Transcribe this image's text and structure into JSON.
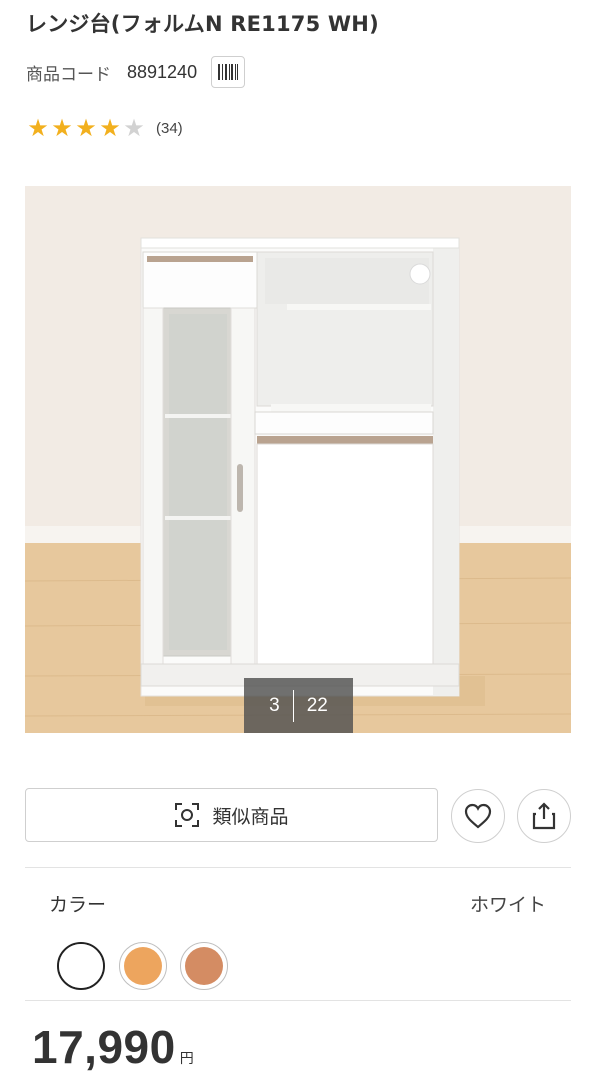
{
  "product": {
    "title": "レンジ台(フォルムN RE1175 WH)",
    "code_label": "商品コード",
    "code_value": "8891240",
    "rating": 4,
    "rating_max": 5,
    "review_count": "(34)"
  },
  "gallery": {
    "current": "3",
    "total": "22"
  },
  "actions": {
    "similar_label": "類似商品",
    "similar_icon": "image-search-icon",
    "favorite_icon": "heart-icon",
    "share_icon": "share-icon"
  },
  "color_section": {
    "label": "カラー",
    "selected_name": "ホワイト",
    "swatches": [
      {
        "name": "white",
        "hex": "#ffffff"
      },
      {
        "name": "orange",
        "hex": "#eda55e"
      },
      {
        "name": "brown",
        "hex": "#d48c63"
      }
    ]
  },
  "price": {
    "amount": "17,990",
    "unit": "円"
  }
}
